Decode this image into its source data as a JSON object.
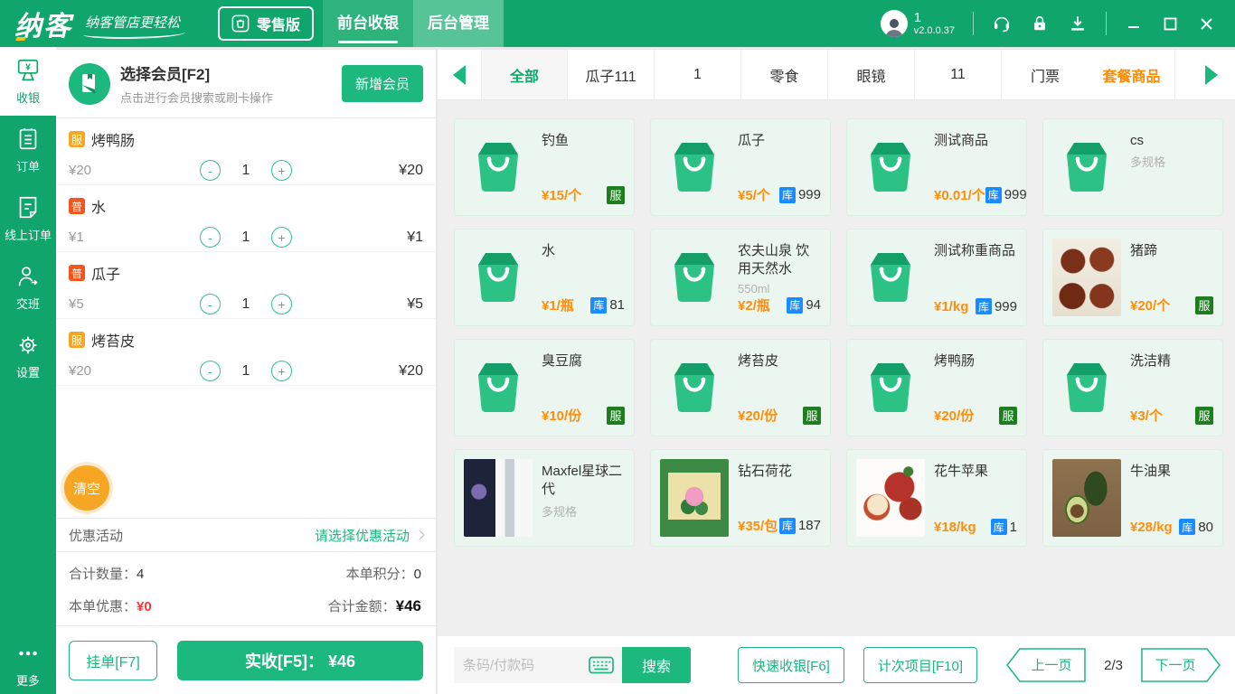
{
  "topbar": {
    "logo": "纳客",
    "slogan": "纳客管店更轻松",
    "edition": "零售版",
    "tabs": [
      {
        "label": "前台收银",
        "active": true
      },
      {
        "label": "后台管理",
        "active": false
      }
    ],
    "user_count": "1",
    "version": "v2.0.0.37"
  },
  "sidebar": {
    "items": [
      {
        "label": "收银",
        "icon": "cash-register",
        "active": true
      },
      {
        "label": "订单",
        "icon": "orders",
        "active": false
      },
      {
        "label": "线上订单",
        "icon": "online-orders",
        "active": false
      },
      {
        "label": "交班",
        "icon": "shift-change",
        "active": false
      },
      {
        "label": "设置",
        "icon": "settings",
        "active": false
      }
    ],
    "more_label": "更多"
  },
  "cart": {
    "member": {
      "title": "选择会员[F2]",
      "subtitle": "点击进行会员搜索或刷卡操作",
      "add_button": "新增会员"
    },
    "items": [
      {
        "badge": "服",
        "badge_type": "service",
        "name": "烤鸭肠",
        "price": "¥20",
        "qty": "1",
        "total": "¥20"
      },
      {
        "badge": "普",
        "badge_type": "normal",
        "name": "水",
        "price": "¥1",
        "qty": "1",
        "total": "¥1"
      },
      {
        "badge": "普",
        "badge_type": "normal",
        "name": "瓜子",
        "price": "¥5",
        "qty": "1",
        "total": "¥5"
      },
      {
        "badge": "服",
        "badge_type": "service",
        "name": "烤苔皮",
        "price": "¥20",
        "qty": "1",
        "total": "¥20"
      }
    ],
    "clear_button": "清空",
    "promo": {
      "label": "优惠活动",
      "action": "请选择优惠活动"
    },
    "summary": {
      "qty_label": "合计数量：",
      "qty": "4",
      "points_label": "本单积分：",
      "points": "0",
      "discount_label": "本单优惠：",
      "discount": "¥0",
      "total_label": "合计金额：",
      "total": "¥46"
    },
    "hold_button": "挂单[F7]",
    "pay_button": "实收[F5]：  ¥46"
  },
  "categories": {
    "tabs": [
      {
        "label": "全部",
        "active": true
      },
      {
        "label": "瓜子111"
      },
      {
        "label": "1"
      },
      {
        "label": "零食"
      },
      {
        "label": "眼镜"
      },
      {
        "label": "11"
      },
      {
        "label": "门票",
        "no_divider": true
      },
      {
        "label": "套餐商品",
        "highlight": true
      }
    ]
  },
  "products": [
    {
      "name": "钓鱼",
      "price": "¥15/个",
      "badge": "服"
    },
    {
      "name": "瓜子",
      "price": "¥5/个",
      "stock": "999"
    },
    {
      "name": "测试商品",
      "price": "¥0.01/个",
      "stock": "999"
    },
    {
      "name": "cs",
      "spec": "多规格"
    },
    {
      "name": "水",
      "price": "¥1/瓶",
      "stock": "81"
    },
    {
      "name": "农夫山泉 饮用天然水550ml",
      "spec": "550ml",
      "price": "¥2/瓶",
      "stock": "94"
    },
    {
      "name": "测试称重商品",
      "price": "¥1/kg",
      "stock": "999"
    },
    {
      "name": "猪蹄",
      "price": "¥20/个",
      "badge": "服",
      "photo": "pork-trotters"
    },
    {
      "name": "臭豆腐",
      "price": "¥10/份",
      "badge": "服"
    },
    {
      "name": "烤苔皮",
      "price": "¥20/份",
      "badge": "服"
    },
    {
      "name": "烤鸭肠",
      "price": "¥20/份",
      "badge": "服"
    },
    {
      "name": "洗洁精",
      "price": "¥3/个",
      "badge": "服"
    },
    {
      "name": "Maxfel星球二代",
      "spec": "多规格",
      "photo": "vape"
    },
    {
      "name": "钻石荷花",
      "price": "¥35/包",
      "stock": "187",
      "photo": "cigarettes"
    },
    {
      "name": "花牛苹果",
      "price": "¥18/kg",
      "stock": "1",
      "photo": "apples"
    },
    {
      "name": "牛油果",
      "price": "¥28/kg",
      "stock": "80",
      "photo": "avocado"
    }
  ],
  "bottombar": {
    "search_placeholder": "条码/付款码",
    "search_button": "搜索",
    "quick_button": "快速收银[F6]",
    "count_button": "计次项目[F10]",
    "prev_label": "上一页",
    "page_indicator": "2/3",
    "next_label": "下一页"
  },
  "colors": {
    "primary_green": "#0fa56b",
    "accent_green": "#1db87e",
    "price_orange": "#ff8e0d",
    "stock_blue": "#1b8cff",
    "product_service_badge": "#1e7e1f",
    "cart_service_badge": "#f5a623",
    "cart_normal_badge": "#f4551e",
    "clear_orange": "#f5a623",
    "discount_red": "#ff3232",
    "highlight_tab_orange": "#ff8c00"
  }
}
